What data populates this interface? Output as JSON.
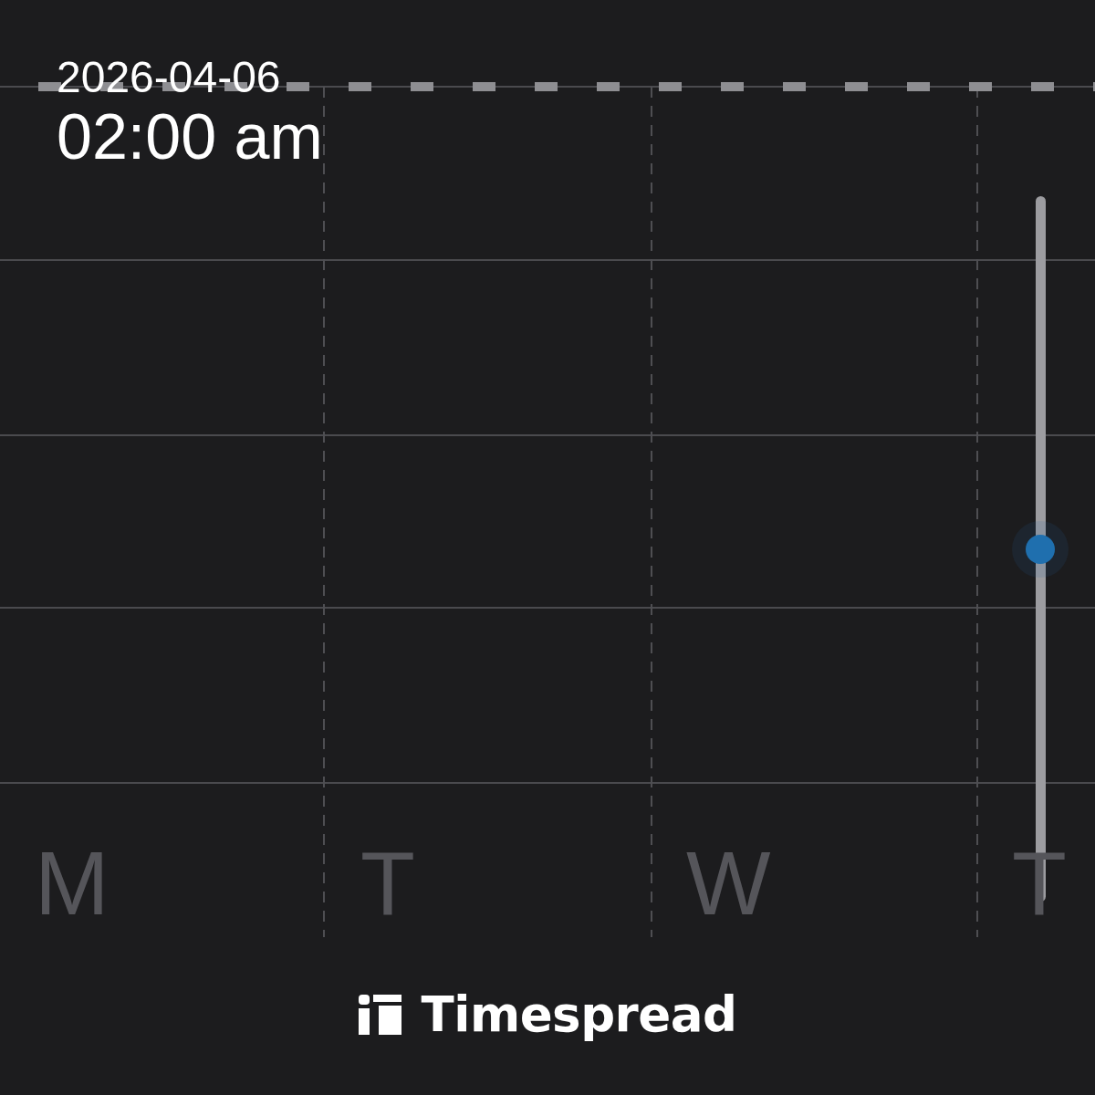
{
  "header": {
    "date": "2026-04-06",
    "time": "02:00 am"
  },
  "days": [
    {
      "label": "M"
    },
    {
      "label": "T"
    },
    {
      "label": "W"
    },
    {
      "label": "T"
    }
  ],
  "slider": {
    "level": 0.5
  },
  "brand": {
    "name": "Timespread"
  }
}
